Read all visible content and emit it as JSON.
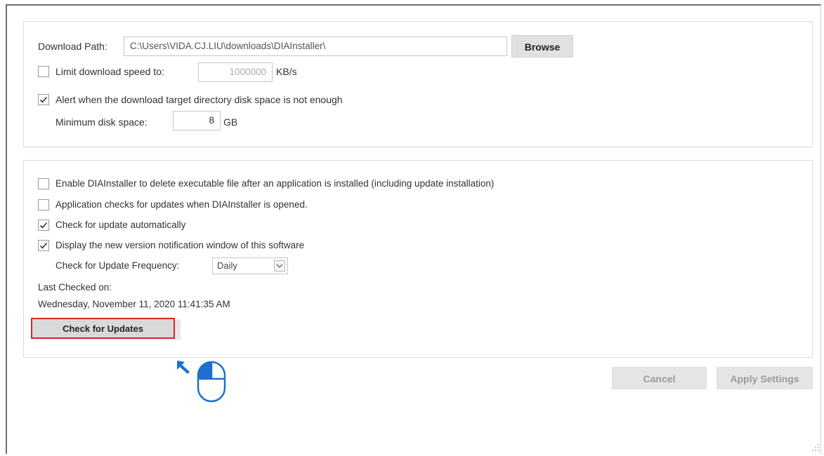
{
  "download": {
    "path_label": "Download Path:",
    "path_value": "C:\\Users\\VIDA.CJ.LIU\\downloads\\DIAInstaller\\",
    "browse_label": "Browse",
    "limit_speed_label": "Limit download speed to:",
    "limit_speed_checked": false,
    "limit_speed_value": "1000000",
    "limit_speed_unit": "KB/s",
    "alert_label": "Alert when the download target directory disk space is not enough",
    "alert_checked": true,
    "min_disk_label": "Minimum disk space:",
    "min_disk_value": "8",
    "min_disk_unit": "GB"
  },
  "updates": {
    "delete_exec_label": "Enable DIAInstaller to delete executable file after an application is installed (including update installation)",
    "delete_exec_checked": false,
    "check_on_open_label": "Application checks for updates when DIAInstaller is opened.",
    "check_on_open_checked": false,
    "auto_check_label": "Check for update automatically",
    "auto_check_checked": true,
    "notify_label": "Display the new version notification window of this software",
    "notify_checked": true,
    "frequency_label": "Check for Update Frequency:",
    "frequency_value": "Daily",
    "last_checked_label": "Last Checked on:",
    "last_checked_value": "Wednesday, November 11, 2020  11:41:35 AM",
    "check_button_label": "Check for Updates"
  },
  "footer": {
    "cancel_label": "Cancel",
    "apply_label": "Apply Settings"
  },
  "colors": {
    "highlight_border": "#d62828",
    "hint_blue": "#1e6fd0"
  },
  "icons": {
    "mouse_hint": "mouse-left-click-icon",
    "pointer_arrow": "arrow-up-left-icon",
    "resize_grip": "resize-grip-icon"
  }
}
